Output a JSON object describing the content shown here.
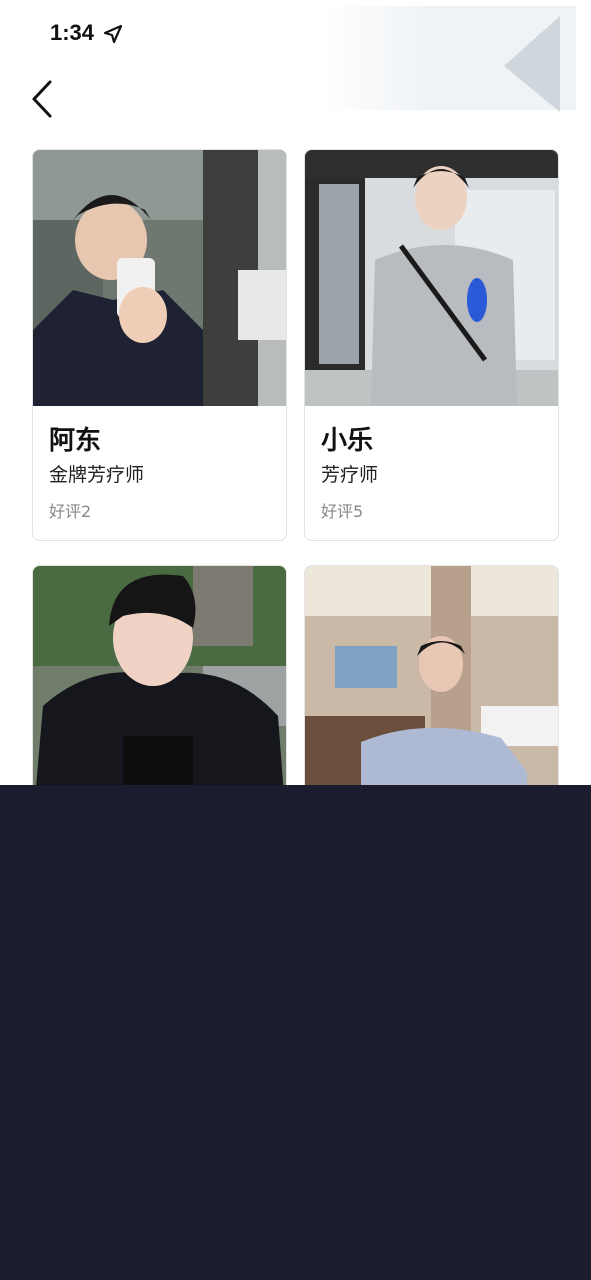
{
  "status_bar": {
    "time": "1:34",
    "location_icon": "location-arrow-icon"
  },
  "nav": {
    "back_icon": "chevron-left-icon"
  },
  "therapists": [
    {
      "name": "阿东",
      "title": "金牌芳疗师",
      "rating": "好评2"
    },
    {
      "name": "小乐",
      "title": "芳疗师",
      "rating": "好评5"
    },
    {
      "name": "",
      "title": "",
      "rating": ""
    },
    {
      "name": "",
      "title": "",
      "rating": ""
    }
  ],
  "colors": {
    "background": "#ffffff",
    "bottom_panel": "#1b1d2e",
    "card_border": "#e3e3e3",
    "rating_text": "#888888"
  }
}
